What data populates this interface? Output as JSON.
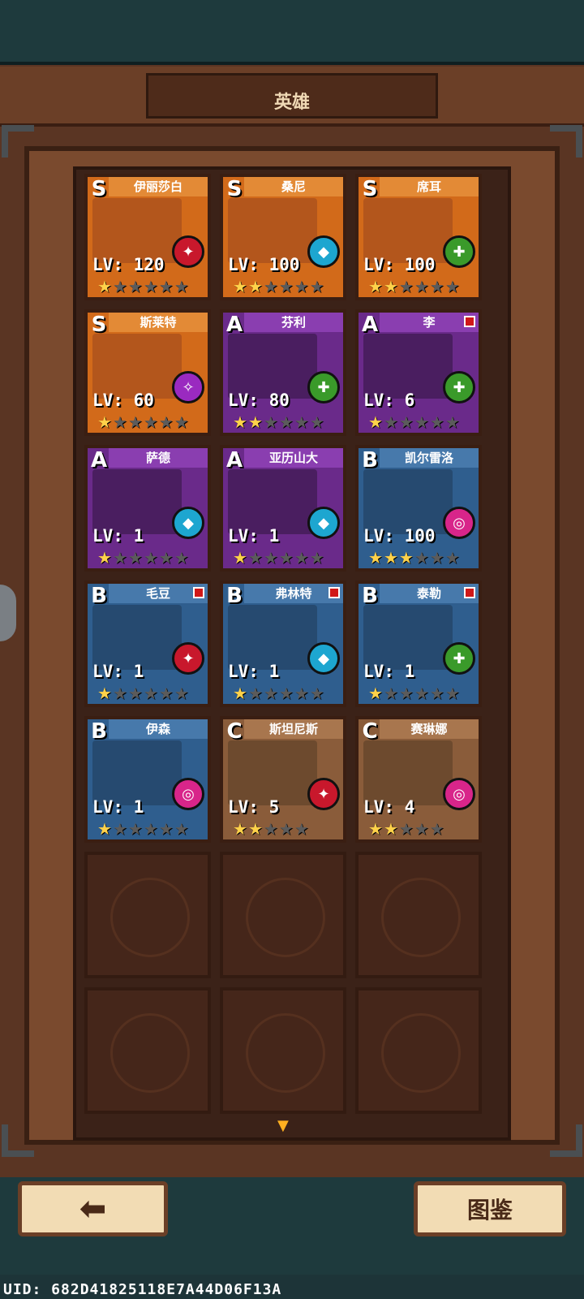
{
  "header": {
    "title": "英雄"
  },
  "heroes": [
    {
      "name": "伊丽莎白",
      "rank": "S",
      "level": "LV: 120",
      "stars": 1,
      "max_stars": 6,
      "element": "red",
      "new": false
    },
    {
      "name": "桑尼",
      "rank": "S",
      "level": "LV: 100",
      "stars": 2,
      "max_stars": 6,
      "element": "cyan",
      "new": false
    },
    {
      "name": "席耳",
      "rank": "S",
      "level": "LV: 100",
      "stars": 2,
      "max_stars": 6,
      "element": "green",
      "new": false
    },
    {
      "name": "斯莱特",
      "rank": "S",
      "level": "LV: 60",
      "stars": 1,
      "max_stars": 6,
      "element": "purple",
      "new": false
    },
    {
      "name": "芬利",
      "rank": "A",
      "level": "LV: 80",
      "stars": 2,
      "max_stars": 6,
      "element": "green",
      "new": false
    },
    {
      "name": "李",
      "rank": "A",
      "level": "LV: 6",
      "stars": 1,
      "max_stars": 6,
      "element": "green",
      "new": true
    },
    {
      "name": "萨德",
      "rank": "A",
      "level": "LV: 1",
      "stars": 1,
      "max_stars": 6,
      "element": "cyan",
      "new": false
    },
    {
      "name": "亚历山大",
      "rank": "A",
      "level": "LV: 1",
      "stars": 1,
      "max_stars": 6,
      "element": "cyan",
      "new": false
    },
    {
      "name": "凯尔雷洛",
      "rank": "B",
      "level": "LV: 100",
      "stars": 3,
      "max_stars": 6,
      "element": "magenta",
      "new": false
    },
    {
      "name": "毛豆",
      "rank": "B",
      "level": "LV: 1",
      "stars": 1,
      "max_stars": 6,
      "element": "red",
      "new": true
    },
    {
      "name": "弗林特",
      "rank": "B",
      "level": "LV: 1",
      "stars": 1,
      "max_stars": 6,
      "element": "cyan",
      "new": true
    },
    {
      "name": "泰勒",
      "rank": "B",
      "level": "LV: 1",
      "stars": 1,
      "max_stars": 6,
      "element": "green",
      "new": true
    },
    {
      "name": "伊森",
      "rank": "B",
      "level": "LV: 1",
      "stars": 1,
      "max_stars": 6,
      "element": "magenta",
      "new": false
    },
    {
      "name": "斯坦尼斯",
      "rank": "C",
      "level": "LV: 5",
      "stars": 2,
      "max_stars": 5,
      "element": "red",
      "new": false
    },
    {
      "name": "赛琳娜",
      "rank": "C",
      "level": "LV: 4",
      "stars": 2,
      "max_stars": 5,
      "element": "magenta",
      "new": false
    }
  ],
  "empty_slots": 6,
  "buttons": {
    "back_icon": "arrow-left-icon",
    "atlas_label": "图鉴"
  },
  "uid": "UID: 682D41825118E7A44D06F13A"
}
